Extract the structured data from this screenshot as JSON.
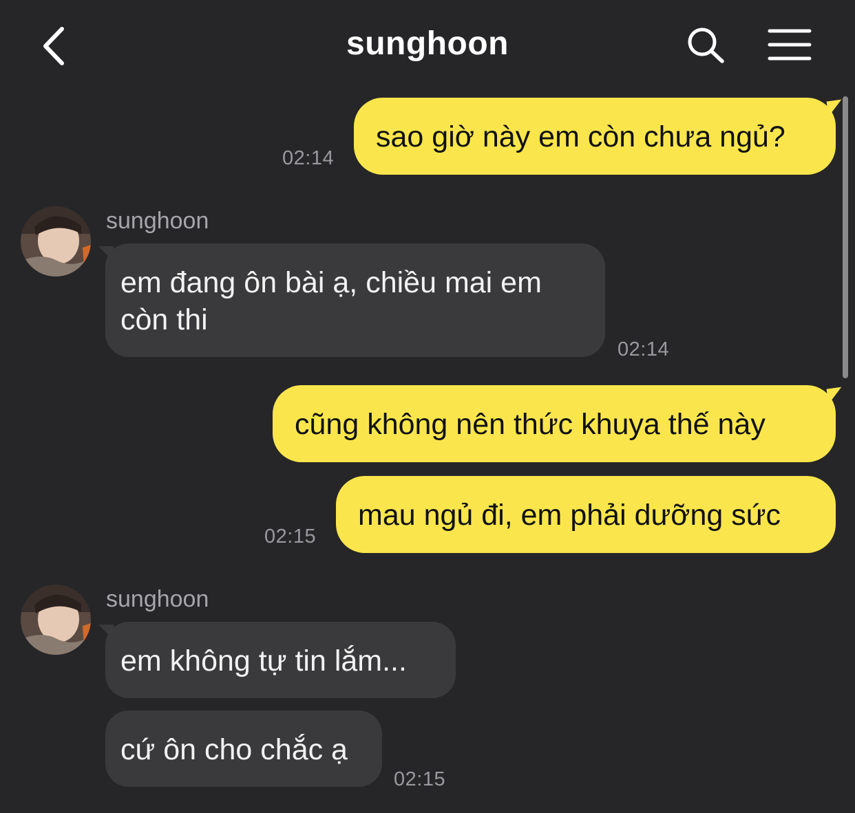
{
  "header": {
    "title": "sunghoon",
    "back_icon": "chevron-left-icon",
    "search_icon": "search-icon",
    "menu_icon": "hamburger-menu-icon"
  },
  "colors": {
    "background": "#262628",
    "my_bubble": "#fae64c",
    "their_bubble": "#3a3a3c",
    "timestamp": "#9a9a9e"
  },
  "messages": [
    {
      "sender": "me",
      "text": "sao giờ này em còn chưa ngủ?",
      "time": "02:14"
    },
    {
      "sender": "sunghoon",
      "name": "sunghoon",
      "text": "em đang ôn bài ạ, chiều mai em còn thi",
      "time": "02:14"
    },
    {
      "sender": "me",
      "text": "cũng không nên thức khuya thế này"
    },
    {
      "sender": "me",
      "text": "mau ngủ đi, em phải dưỡng sức",
      "time": "02:15"
    },
    {
      "sender": "sunghoon",
      "name": "sunghoon",
      "text": "em không tự tin lắm..."
    },
    {
      "sender": "sunghoon",
      "text": "cứ ôn cho chắc ạ",
      "time": "02:15"
    }
  ]
}
